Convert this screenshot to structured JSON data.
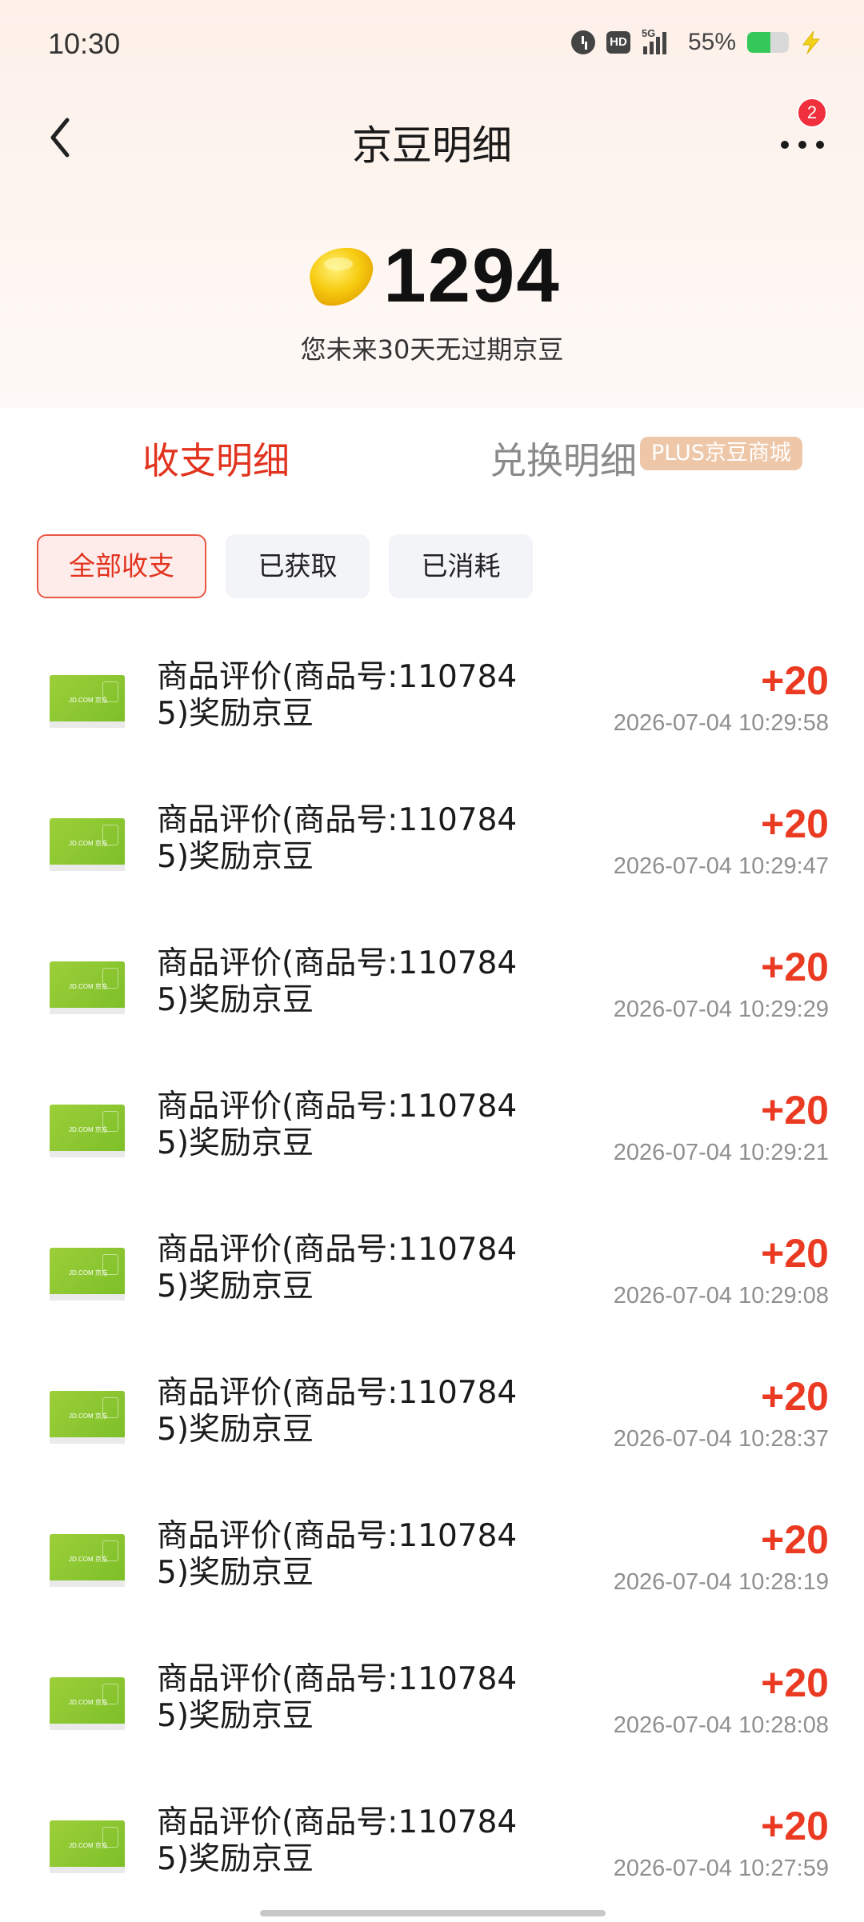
{
  "status_bar": {
    "time": "10:30",
    "network": "5G",
    "hd_label": "HD",
    "battery_percent": "55%",
    "battery_level": 0.55
  },
  "header": {
    "title": "京豆明细",
    "notification_count": "2"
  },
  "balance": {
    "count": "1294",
    "note": "您未来30天无过期京豆"
  },
  "tabs": {
    "main": "收支明细",
    "alt": "兑换明细",
    "alt_tag": "PLUS京豆商城"
  },
  "filters": [
    "全部收支",
    "已获取",
    "已消耗"
  ],
  "records": [
    {
      "title": "商品评价(商品号:1107845)奖励京豆",
      "amount": "+20",
      "time": "2026-07-04 10:29:58"
    },
    {
      "title": "商品评价(商品号:1107845)奖励京豆",
      "amount": "+20",
      "time": "2026-07-04 10:29:47"
    },
    {
      "title": "商品评价(商品号:1107845)奖励京豆",
      "amount": "+20",
      "time": "2026-07-04 10:29:29"
    },
    {
      "title": "商品评价(商品号:1107845)奖励京豆",
      "amount": "+20",
      "time": "2026-07-04 10:29:21"
    },
    {
      "title": "商品评价(商品号:1107845)奖励京豆",
      "amount": "+20",
      "time": "2026-07-04 10:29:08"
    },
    {
      "title": "商品评价(商品号:1107845)奖励京豆",
      "amount": "+20",
      "time": "2026-07-04 10:28:37"
    },
    {
      "title": "商品评价(商品号:1107845)奖励京豆",
      "amount": "+20",
      "time": "2026-07-04 10:28:19"
    },
    {
      "title": "商品评价(商品号:1107845)奖励京豆",
      "amount": "+20",
      "time": "2026-07-04 10:28:08"
    },
    {
      "title": "商品评价(商品号:1107845)奖励京豆",
      "amount": "+20",
      "time": "2026-07-04 10:27:59"
    }
  ],
  "card_thumb_text": "JD.COM 京东",
  "colors": {
    "accent": "#e2331f",
    "amount": "#ea3a22",
    "plus_tag": "#eec7a9",
    "card_green": "#8cc832"
  }
}
